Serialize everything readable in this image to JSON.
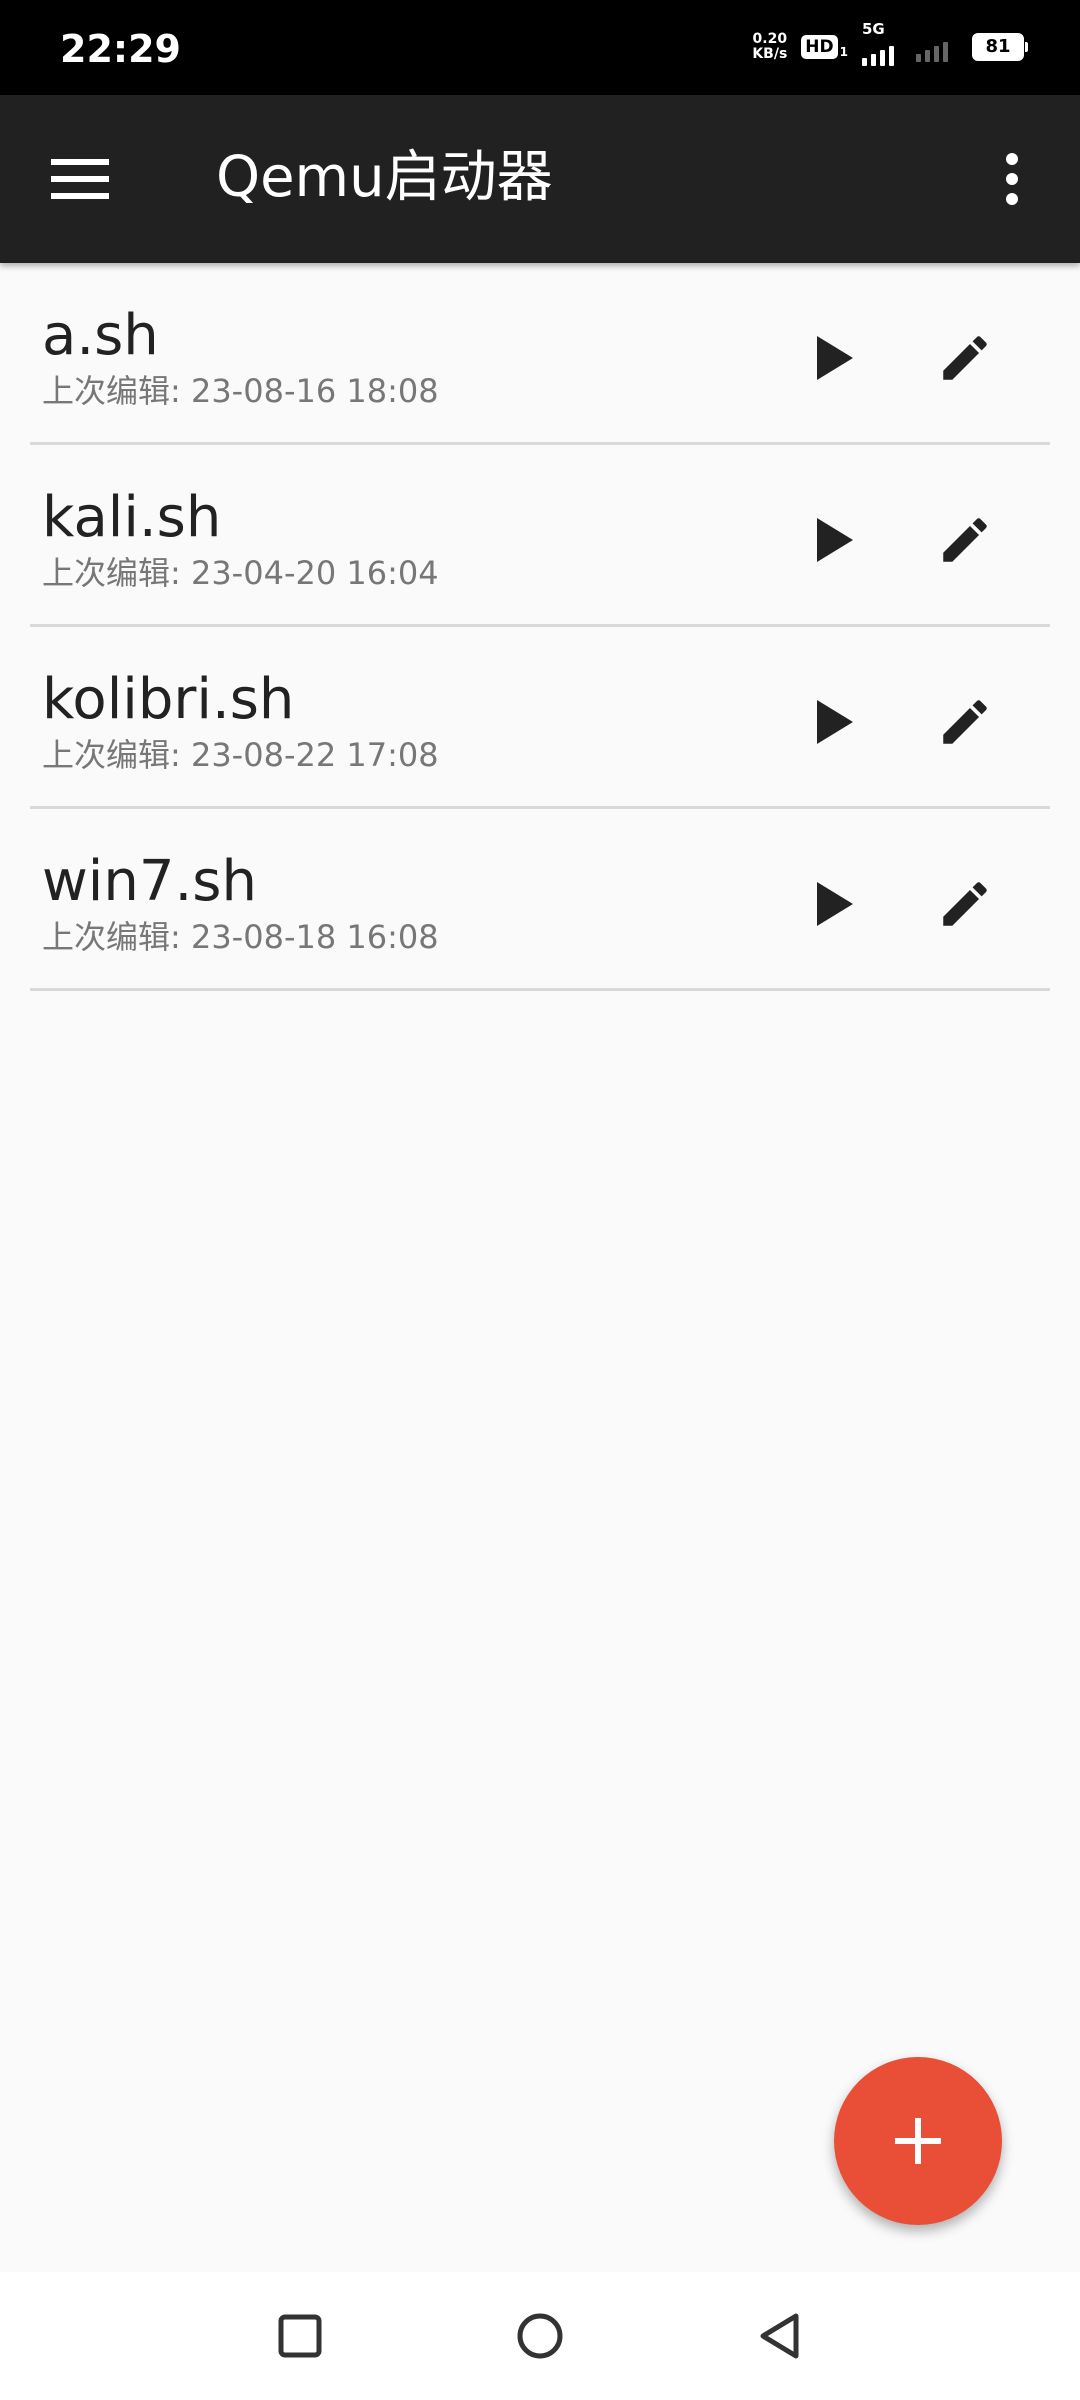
{
  "status_bar": {
    "time": "22:29",
    "net_speed_value": "0.20",
    "net_speed_unit": "KB/s",
    "hd_label": "HD",
    "hd_sub": "1",
    "network_type": "5G",
    "battery_level": "81"
  },
  "app_bar": {
    "title": "Qemu启动器",
    "menu_icon": "hamburger-menu-icon",
    "more_icon": "more-vert-icon"
  },
  "scripts": [
    {
      "name": "a.sh",
      "edited": "上次编辑: 23-08-16 18:08"
    },
    {
      "name": "kali.sh",
      "edited": "上次编辑: 23-04-20 16:04"
    },
    {
      "name": "kolibri.sh",
      "edited": "上次编辑: 23-08-22 17:08"
    },
    {
      "name": "win7.sh",
      "edited": "上次编辑: 23-08-18 16:08"
    }
  ],
  "fab": {
    "icon": "plus-icon",
    "color": "#e94e36"
  },
  "colors": {
    "app_bar": "#212121",
    "background": "#fafafa",
    "accent": "#e94e36"
  }
}
